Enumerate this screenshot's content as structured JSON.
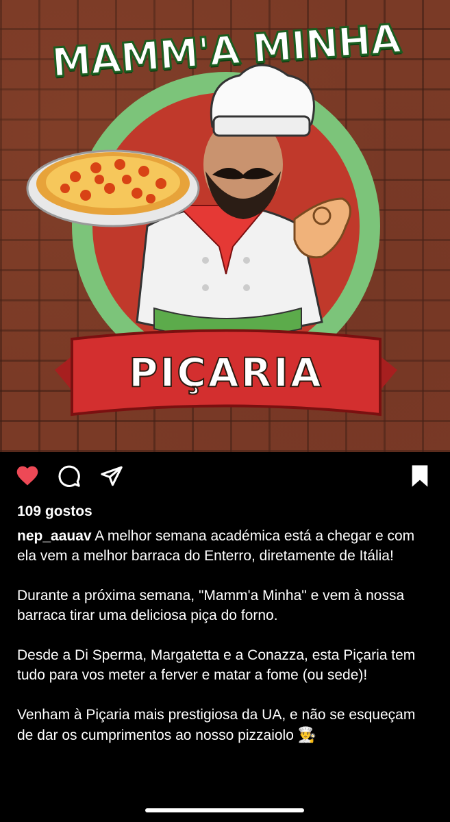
{
  "post": {
    "image": {
      "title_text": "MAMM'A MINHA",
      "banner_text": "PIÇARIA",
      "colors": {
        "green": "#2e8b3d",
        "red": "#c62828",
        "brick": "#7a3a26"
      }
    },
    "actions": {
      "like_icon": "heart-icon",
      "comment_icon": "comment-icon",
      "share_icon": "send-icon",
      "save_icon": "bookmark-icon",
      "liked": true,
      "heart_color": "#ed4956"
    },
    "likes": "109 gostos",
    "caption": {
      "username": "nep_aauav",
      "p1": "A melhor semana académica está a chegar e com ela vem a melhor barraca do Enterro, diretamente de Itália!",
      "p2": "Durante a próxima semana, \"Mamm'a Minha\" e vem à nossa barraca tirar uma deliciosa piça do forno.",
      "p3": "Desde a Di Sperma, Margatetta e a Conazza, esta Piçaria tem tudo para vos meter a ferver e matar a fome (ou sede)!",
      "p4": "Venham à Piçaria mais prestigiosa da UA, e não se esqueçam de dar os cumprimentos ao nosso pizzaiolo",
      "emoji": "👨‍🍳"
    }
  }
}
